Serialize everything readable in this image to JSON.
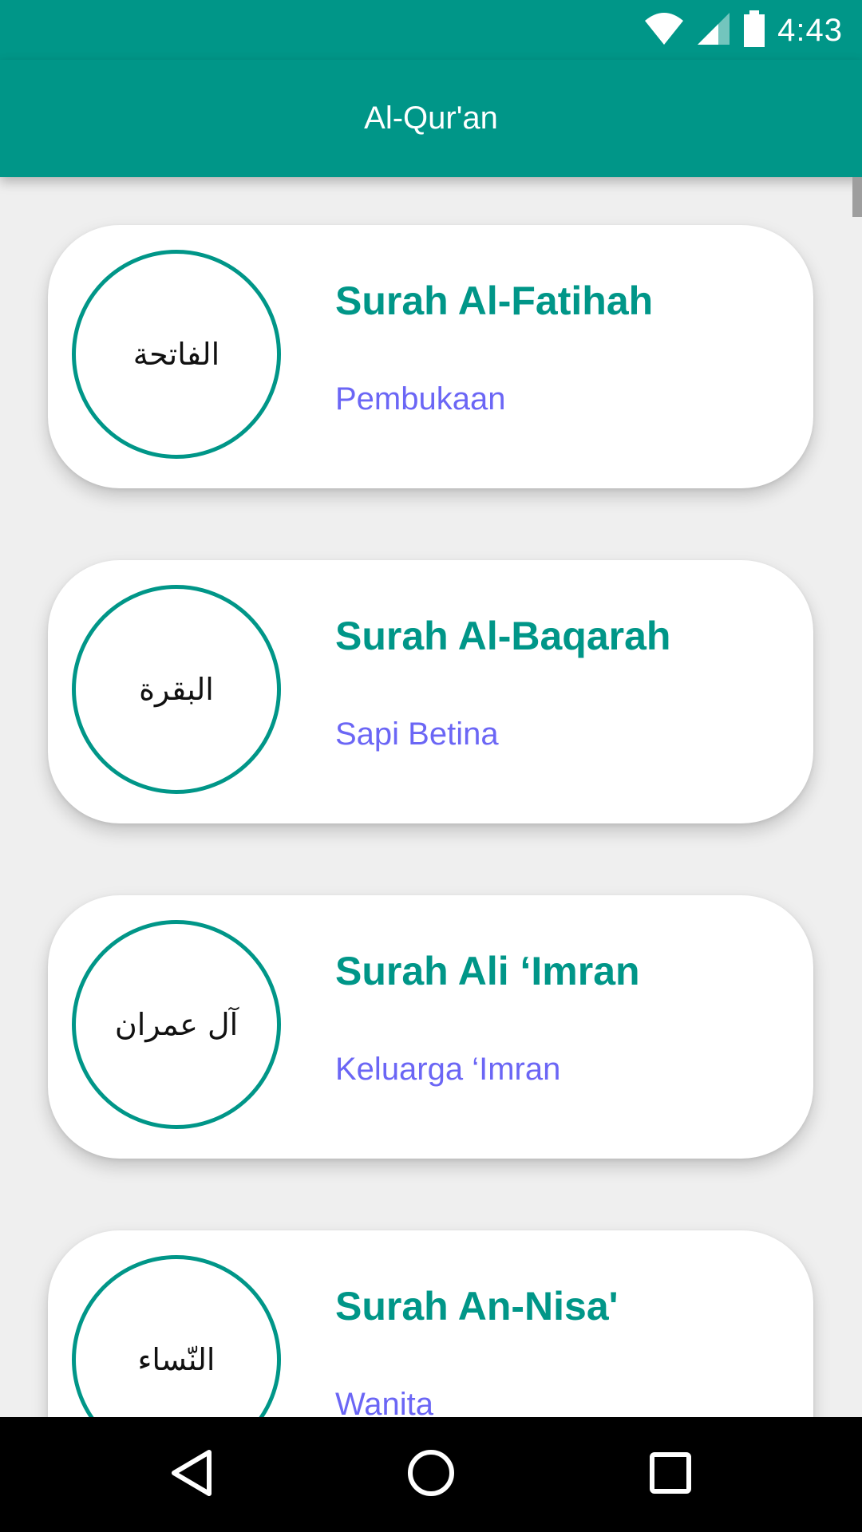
{
  "status_bar": {
    "time": "4:43",
    "icons": [
      "wifi-icon",
      "cellular-signal-icon",
      "battery-icon"
    ],
    "background": "#009688"
  },
  "app_bar": {
    "title": "Al-Qur'an",
    "background": "#009688"
  },
  "surahs": [
    {
      "arabic": "الفاتحة",
      "name": "Surah Al-Fatihah",
      "meaning": "Pembukaan"
    },
    {
      "arabic": "البقرة",
      "name": "Surah Al-Baqarah",
      "meaning": "Sapi Betina"
    },
    {
      "arabic": "آل عمران",
      "name": "Surah Ali ‘Imran",
      "meaning": "Keluarga ‘Imran"
    },
    {
      "arabic": "النّساء",
      "name": "Surah An-Nisa'",
      "meaning": "Wanita"
    }
  ],
  "nav_bar": {
    "icons": [
      "back-icon",
      "home-icon",
      "recents-icon"
    ]
  },
  "colors": {
    "accent": "#009688",
    "meaning_text": "#6b66f5",
    "background": "#efefef"
  }
}
